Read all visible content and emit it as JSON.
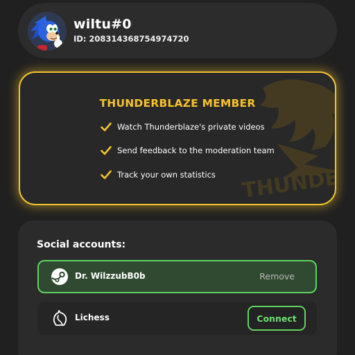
{
  "profile": {
    "username": "wiltu#0",
    "id_text": "ID: 208314368754974720"
  },
  "member_card": {
    "title": "THUNDERBLAZE MEMBER",
    "perks": [
      {
        "label": "Watch Thunderblaze's private videos",
        "icon": "check-icon"
      },
      {
        "label": "Send feedback to the moderation team",
        "icon": "check-icon"
      },
      {
        "label": "Track your own statistics",
        "icon": "check-icon"
      }
    ],
    "watermark_text": "THUNDERB",
    "accent_color": "#f2c230"
  },
  "social": {
    "title": "Social accounts:",
    "accounts": [
      {
        "service_icon": "steam-icon",
        "name": "Dr. WilzzubB0b",
        "action_label": "Remove",
        "connected": true
      },
      {
        "service_icon": "lichess-icon",
        "name": "Lichess",
        "action_label": "Connect",
        "connected": false
      }
    ],
    "connected_color": "#5fd45f"
  }
}
